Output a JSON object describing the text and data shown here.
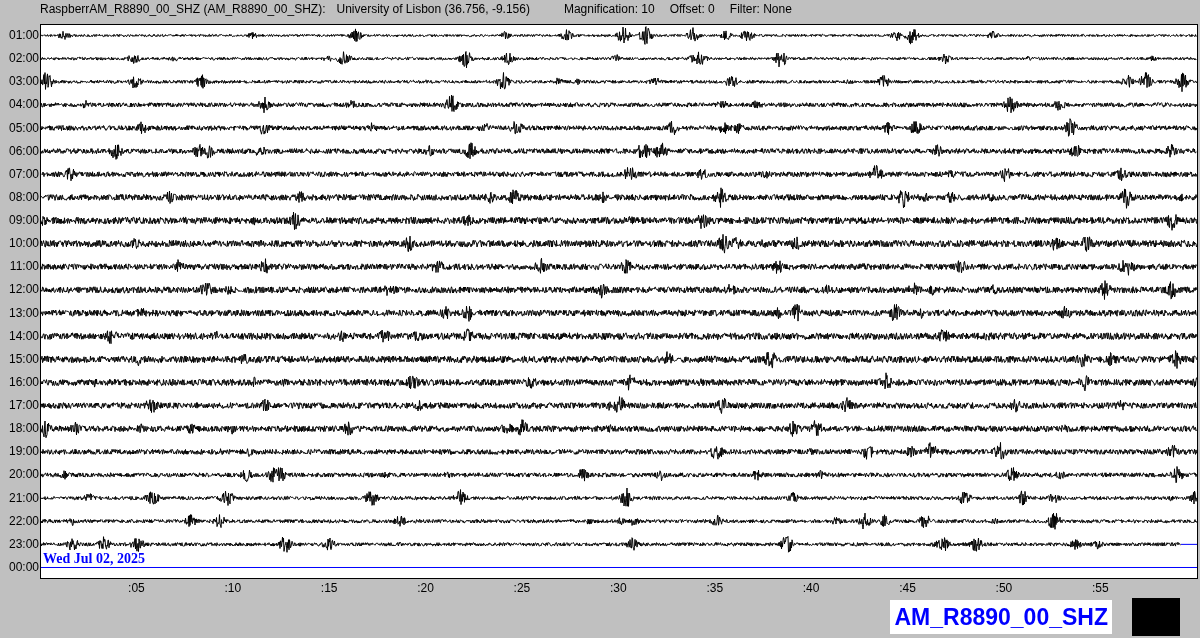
{
  "header": {
    "title": "RaspberrAM_R8890_00_SHZ (AM_R8890_00_SHZ):",
    "location": "University of Lisbon (36.756, -9.156)",
    "magnification": "Magnification: 10",
    "offset": "Offset: 0",
    "filter": "Filter: None"
  },
  "rows": [
    {
      "label": "01:00",
      "kind": "trace"
    },
    {
      "label": "02:00",
      "kind": "trace"
    },
    {
      "label": "03:00",
      "kind": "trace"
    },
    {
      "label": "04:00",
      "kind": "trace"
    },
    {
      "label": "05:00",
      "kind": "trace"
    },
    {
      "label": "06:00",
      "kind": "trace"
    },
    {
      "label": "07:00",
      "kind": "trace"
    },
    {
      "label": "08:00",
      "kind": "trace"
    },
    {
      "label": "09:00",
      "kind": "trace"
    },
    {
      "label": "10:00",
      "kind": "trace"
    },
    {
      "label": "11:00",
      "kind": "trace"
    },
    {
      "label": "12:00",
      "kind": "trace"
    },
    {
      "label": "13:00",
      "kind": "trace"
    },
    {
      "label": "14:00",
      "kind": "trace"
    },
    {
      "label": "15:00",
      "kind": "trace"
    },
    {
      "label": "16:00",
      "kind": "trace"
    },
    {
      "label": "17:00",
      "kind": "trace"
    },
    {
      "label": "18:00",
      "kind": "trace"
    },
    {
      "label": "19:00",
      "kind": "trace"
    },
    {
      "label": "20:00",
      "kind": "trace"
    },
    {
      "label": "21:00",
      "kind": "trace"
    },
    {
      "label": "22:00",
      "kind": "trace"
    },
    {
      "label": "23:00",
      "kind": "current"
    },
    {
      "label": "00:00",
      "kind": "empty"
    }
  ],
  "date": "Wed Jul 02, 2025",
  "x_ticks": [
    ":05",
    ":10",
    ":15",
    ":20",
    ":25",
    ":30",
    ":35",
    ":40",
    ":45",
    ":50",
    ":55"
  ],
  "station_code": "AM_R8890_00_SHZ"
}
